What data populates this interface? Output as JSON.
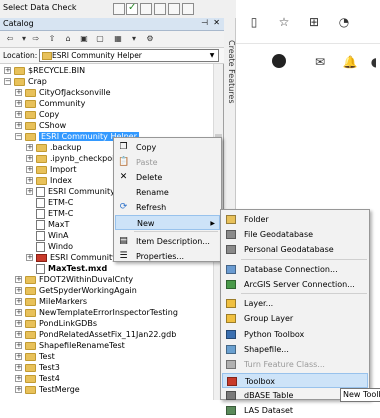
{
  "topbar": {
    "title": "Select Data Check"
  },
  "catalog": {
    "title": "Catalog",
    "location_label": "Location:",
    "location_value": "ESRI Community Helper",
    "tree": [
      {
        "label": "$RECYCLE.BIN",
        "icon": "folder",
        "state": "plus"
      },
      {
        "label": "Crap",
        "icon": "folder",
        "state": "minus"
      },
      {
        "label": "CityOfJacksonville",
        "icon": "folder",
        "state": "plus"
      },
      {
        "label": "Community",
        "icon": "folder",
        "state": "plus"
      },
      {
        "label": "Copy",
        "icon": "folder",
        "state": "plus"
      },
      {
        "label": "CShow",
        "icon": "folder",
        "state": "plus"
      },
      {
        "label": "ESRI Community Helper",
        "icon": "folder",
        "state": "minus",
        "selected": true
      },
      {
        "label": ".backup",
        "icon": "folder",
        "state": "plus"
      },
      {
        "label": ".ipynb_checkpoints",
        "icon": "folder",
        "state": "plus"
      },
      {
        "label": "Import",
        "icon": "folder",
        "state": "plus"
      },
      {
        "label": "Index",
        "icon": "folder",
        "state": "plus"
      },
      {
        "label": "ESRI Community Helper",
        "icon": "file",
        "state": "plus"
      },
      {
        "label": "ETM-C",
        "icon": "file",
        "state": "none"
      },
      {
        "label": "ETM-C",
        "icon": "file",
        "state": "none"
      },
      {
        "label": "MaxT",
        "icon": "file",
        "state": "none"
      },
      {
        "label": "WinA",
        "icon": "file",
        "state": "none"
      },
      {
        "label": "Windo",
        "icon": "file",
        "state": "none"
      },
      {
        "label": "ESRI Community Helper.tbx",
        "icon": "toolbox",
        "state": "plus"
      },
      {
        "label": "MaxTest.mxd",
        "icon": "file",
        "state": "none",
        "bold": true
      },
      {
        "label": "FDOT2WithinDuvalCnty",
        "icon": "folder",
        "state": "plus"
      },
      {
        "label": "GetSpyderWorkingAgain",
        "icon": "folder",
        "state": "plus"
      },
      {
        "label": "MileMarkers",
        "icon": "folder",
        "state": "plus"
      },
      {
        "label": "NewTemplateErrorInspectorTesting",
        "icon": "folder",
        "state": "plus"
      },
      {
        "label": "PondLinkGDBs",
        "icon": "folder",
        "state": "plus"
      },
      {
        "label": "PondRelatedAssetFix_11Jan22.gdb",
        "icon": "folder",
        "state": "plus"
      },
      {
        "label": "ShapefileRenameTest",
        "icon": "folder",
        "state": "plus"
      },
      {
        "label": "Test",
        "icon": "folder",
        "state": "plus"
      },
      {
        "label": "Test3",
        "icon": "folder",
        "state": "plus"
      },
      {
        "label": "Test4",
        "icon": "folder",
        "state": "plus"
      },
      {
        "label": "TestMerge",
        "icon": "folder",
        "state": "plus"
      }
    ]
  },
  "create_features_tab": "Create Features",
  "context_menu": {
    "items": [
      {
        "label": "Copy",
        "icon": "copy-icon",
        "glyph": "❐",
        "disabled": false
      },
      {
        "label": "Paste",
        "icon": "paste-icon",
        "glyph": "📋",
        "disabled": true
      },
      {
        "label": "Delete",
        "icon": "delete-icon",
        "glyph": "✕",
        "disabled": false
      },
      {
        "label": "Rename",
        "icon": "",
        "glyph": "",
        "disabled": false
      },
      {
        "label": "Refresh",
        "icon": "refresh-icon",
        "glyph": "⟳",
        "disabled": false
      },
      {
        "label": "New",
        "icon": "",
        "glyph": "",
        "disabled": false,
        "highlighted": true,
        "submenu": true
      },
      {
        "label": "Item Description...",
        "icon": "description-icon",
        "glyph": "▤",
        "disabled": false
      },
      {
        "label": "Properties...",
        "icon": "properties-icon",
        "glyph": "☰",
        "disabled": false
      }
    ]
  },
  "new_submenu": {
    "items": [
      {
        "label": "Folder",
        "icon": "folder-icon"
      },
      {
        "label": "File Geodatabase",
        "icon": "geodatabase-icon"
      },
      {
        "label": "Personal Geodatabase",
        "icon": "geodatabase-icon"
      },
      {
        "label": "Database Connection...",
        "icon": "database-connection-icon"
      },
      {
        "label": "ArcGIS Server Connection...",
        "icon": "server-connection-icon"
      },
      {
        "label": "Layer...",
        "icon": "layer-icon"
      },
      {
        "label": "Group Layer",
        "icon": "group-layer-icon"
      },
      {
        "label": "Python Toolbox",
        "icon": "python-toolbox-icon"
      },
      {
        "label": "Shapefile...",
        "icon": "shapefile-icon"
      },
      {
        "label": "Turn Feature Class...",
        "icon": "feature-class-icon",
        "disabled": true
      },
      {
        "label": "Toolbox",
        "icon": "toolbox-icon",
        "highlighted": true
      },
      {
        "label": "dBASE Table",
        "icon": "dbase-table-icon"
      },
      {
        "label": "LAS Dataset",
        "icon": "las-dataset-icon"
      }
    ]
  },
  "tooltip": "New Toolbox",
  "colors": {
    "selection": "#3399ff",
    "menu_highlight": "#cde3f8",
    "folder": "#e8c15a",
    "toolbox": "#c83a2a"
  }
}
